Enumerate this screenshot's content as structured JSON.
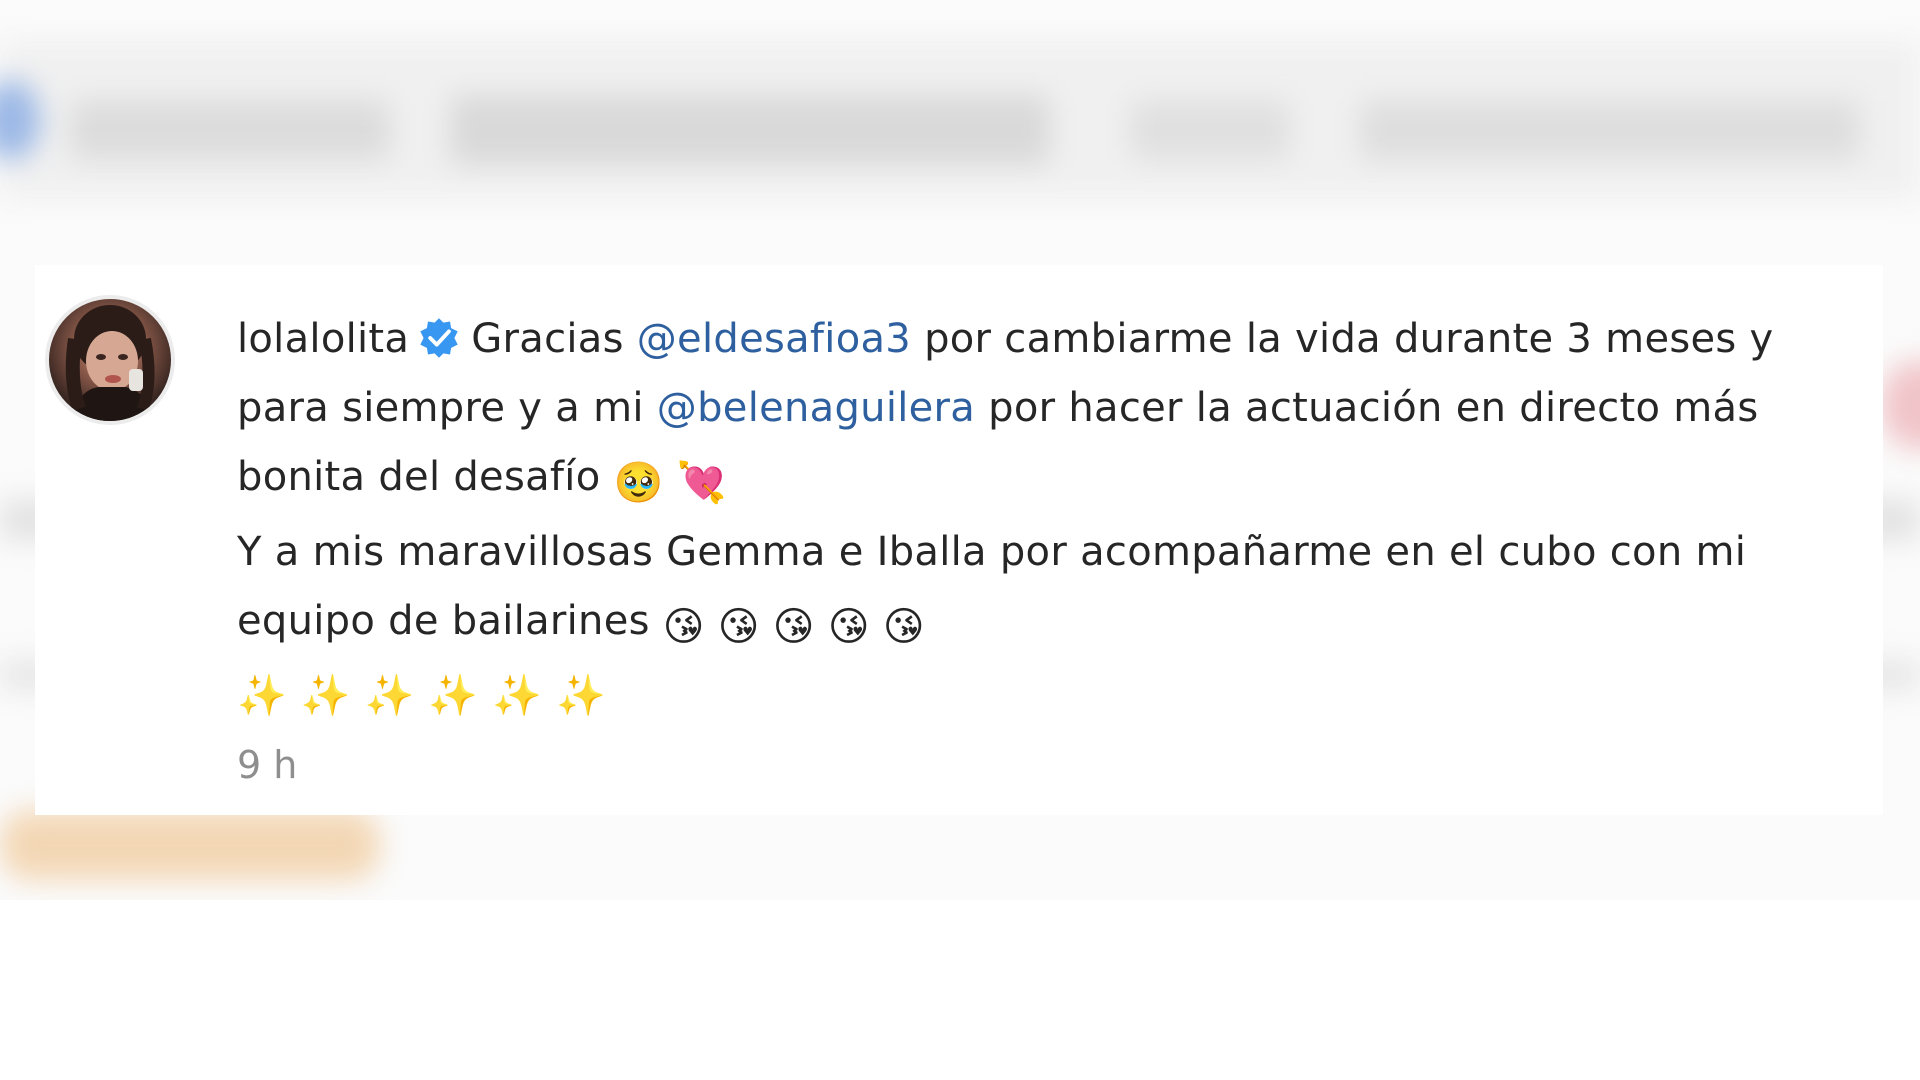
{
  "comment": {
    "username": "lolalolita",
    "verified_icon": "verified-badge-icon",
    "text_1": "Gracias ",
    "mention_1": "@eldesafioa3",
    "text_2": " por cambiarme la vida durante 3 meses y para siempre y a mi ",
    "mention_2": "@belenaguilera",
    "text_3": " por hacer la actuación en directo más bonita del desafío ",
    "emoji_1": "🥹",
    "emoji_2": "💘",
    "text_4": "Y a mis maravillosas Gemma e Iballa por acompañarme en el cubo con mi equipo de bailarines ",
    "kiss_emojis": "😘 😘 😘 😘 😘",
    "sparkles": "✨✨✨✨✨✨",
    "timestamp": "9 h"
  },
  "colors": {
    "text": "#262626",
    "mention": "#2e5f9e",
    "verified": "#3897f0",
    "timestamp": "#8e8e8e"
  }
}
